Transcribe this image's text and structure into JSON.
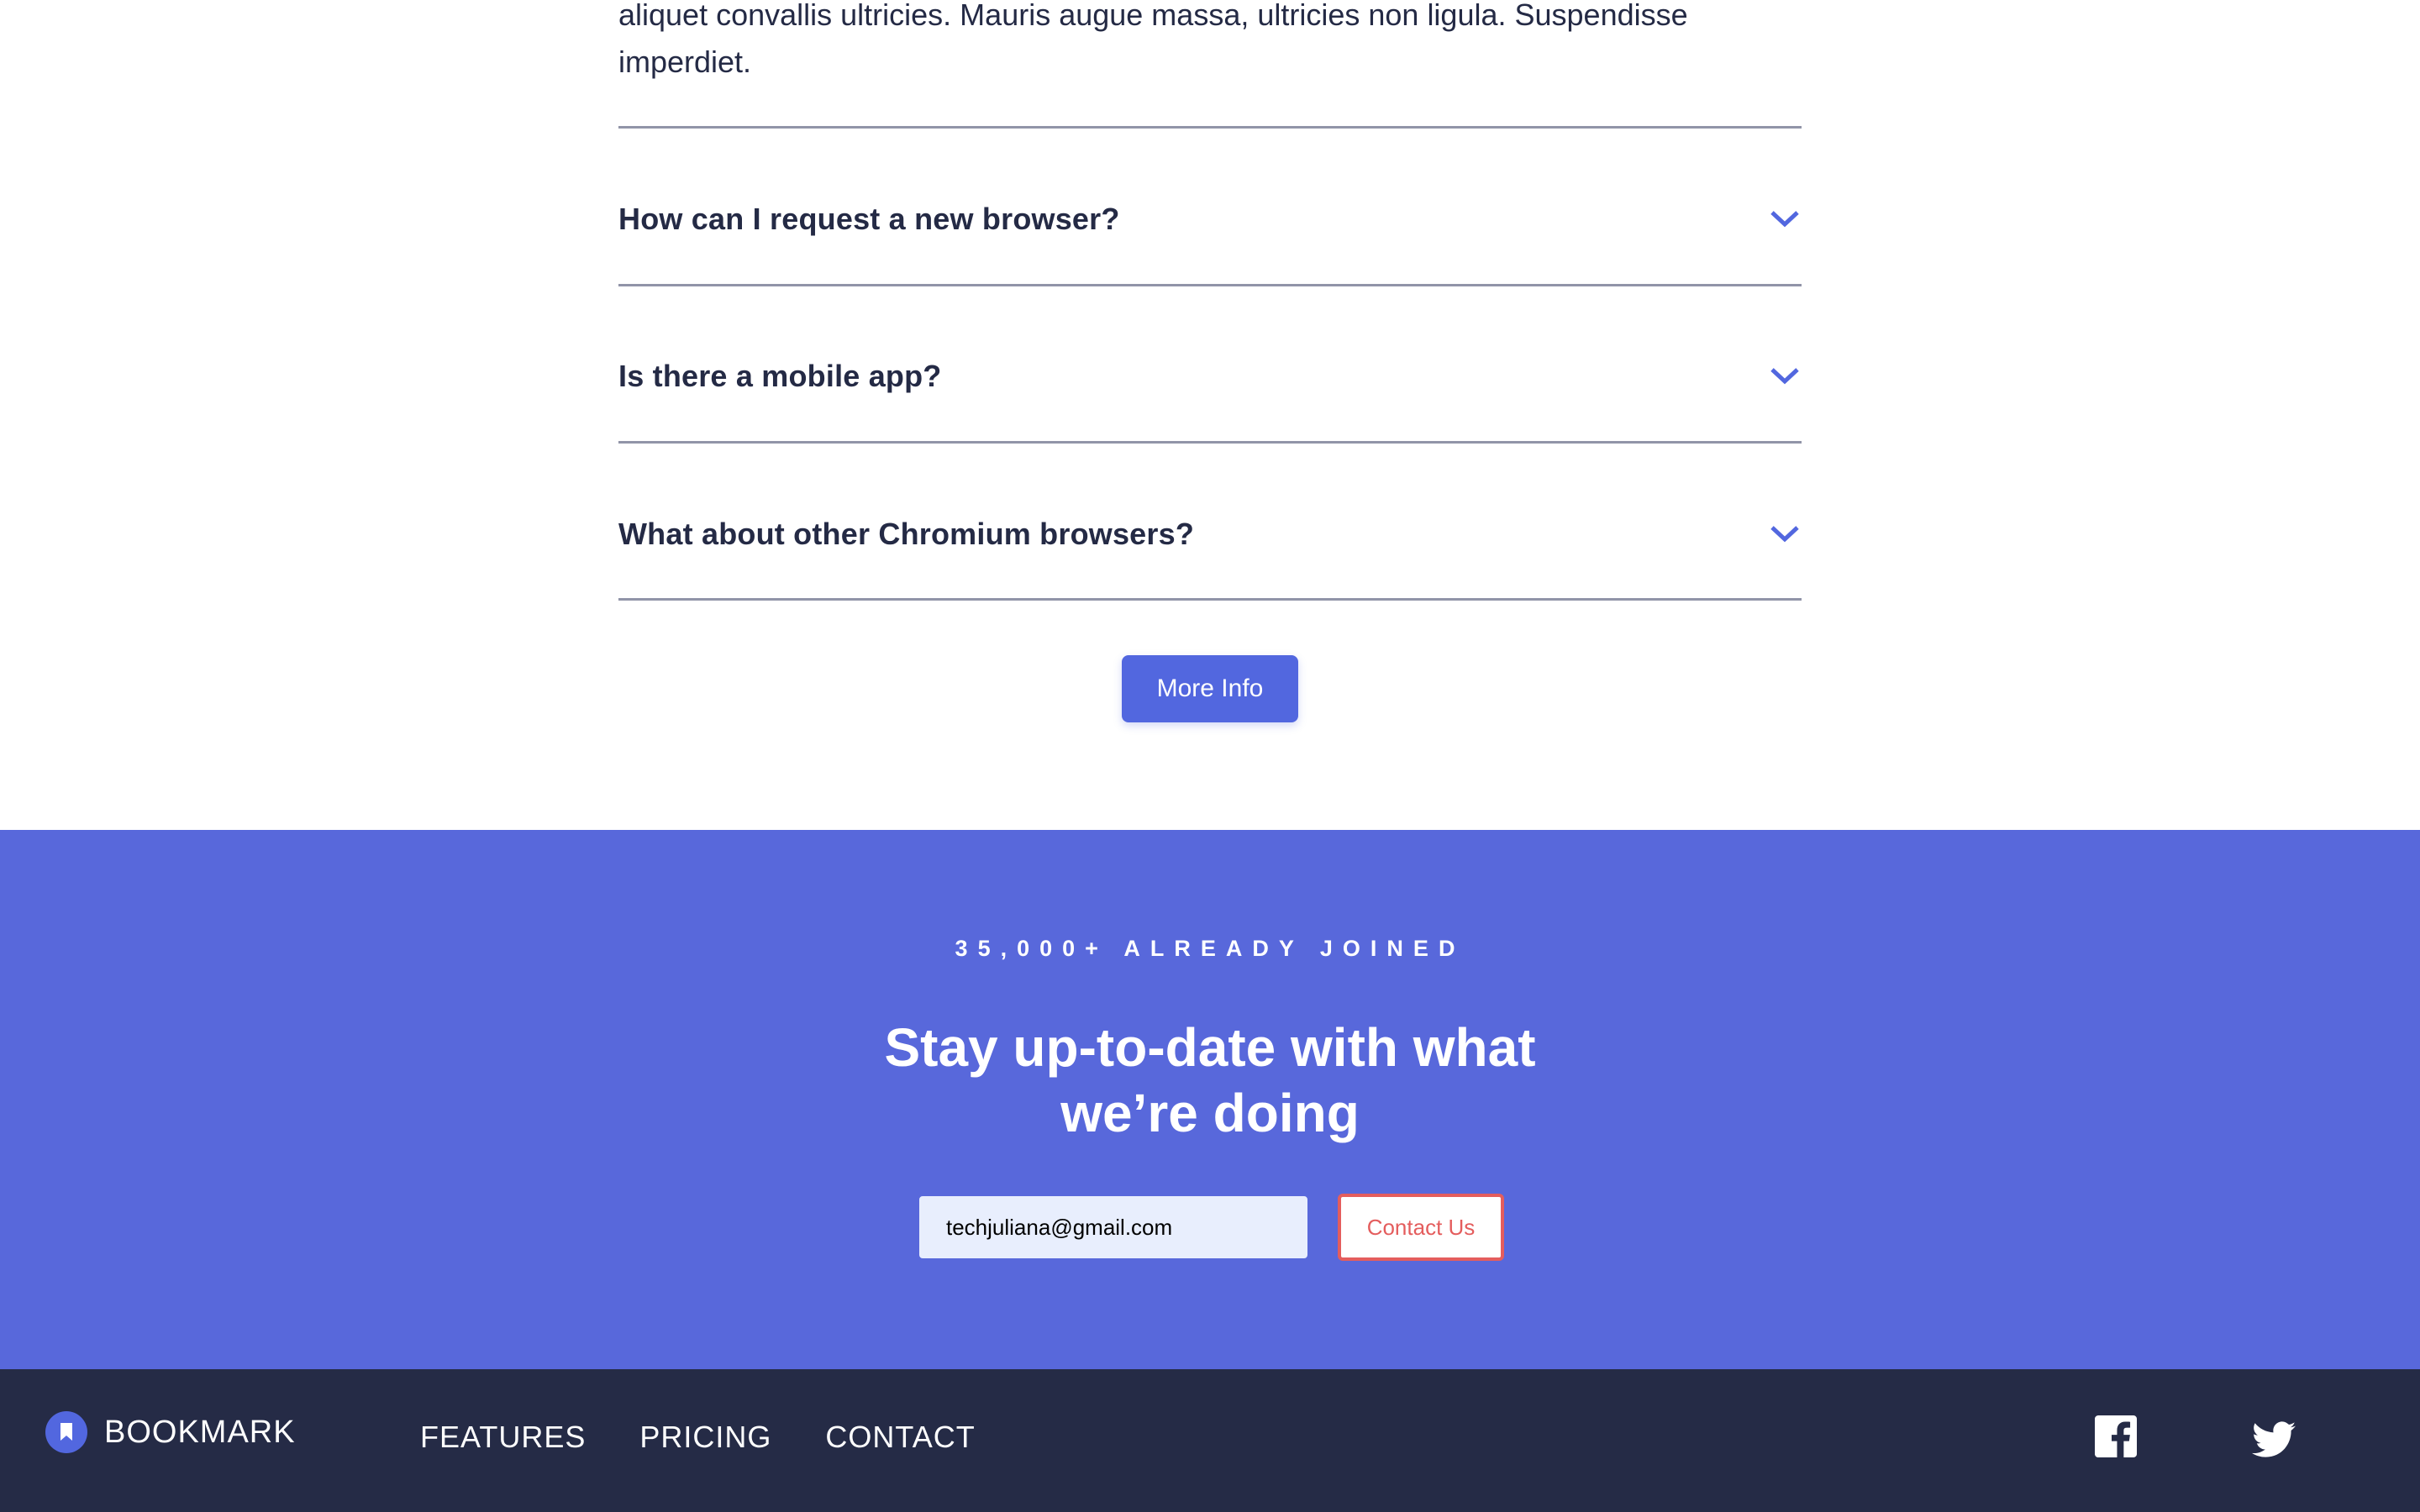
{
  "faq": {
    "answer_text": "aliquet convallis ultricies. Mauris augue massa, ultricies non ligula. Suspendisse imperdiet.",
    "items": [
      {
        "question": "How can I request a new browser?"
      },
      {
        "question": "Is there a mobile app?"
      },
      {
        "question": "What about other Chromium browsers?"
      }
    ],
    "more_info_label": "More Info",
    "accent_color": "#5267df"
  },
  "newsletter": {
    "joined_label": "35,000+ ALREADY JOINED",
    "title": "Stay up-to-date with what we’re doing",
    "email_value": "techjuliana@gmail.com",
    "contact_label": "Contact Us",
    "background_color": "#5868db",
    "error_color": "#e45d5d"
  },
  "footer": {
    "logo_text": "BOOKMARK",
    "links": [
      {
        "label": "FEATURES"
      },
      {
        "label": "PRICING"
      },
      {
        "label": "CONTACT"
      }
    ],
    "social": [
      {
        "icon": "facebook-icon"
      },
      {
        "icon": "twitter-icon"
      }
    ],
    "background_color": "#252b46"
  }
}
